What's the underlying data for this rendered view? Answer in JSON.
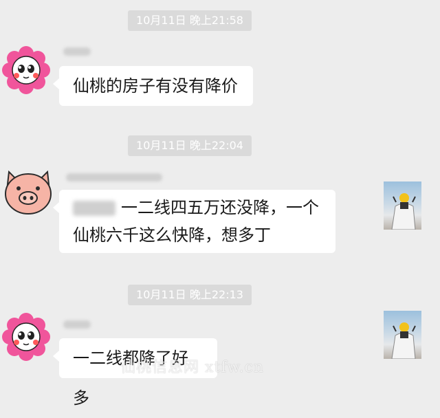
{
  "messages": [
    {
      "timestamp": "10月11日 晚上21:58",
      "sender_avatar": "flower-avatar",
      "text": "仙桃的房子有没有降价"
    },
    {
      "timestamp": "10月11日 晚上22:04",
      "sender_avatar": "pig-avatar",
      "line1": "一二线四五万还没降，一个",
      "line2": "仙桃六千这么快降，想多丁"
    },
    {
      "timestamp": "10月11日 晚上22:13",
      "sender_avatar": "flower-avatar",
      "text": "一二线都降了好多"
    }
  ],
  "watermark": "仙桃信息网 xtfw.cn",
  "colors": {
    "background": "#ededed",
    "bubble": "#ffffff",
    "timestamp_bg": "#dadada",
    "flower_petal": "#f0559b"
  }
}
